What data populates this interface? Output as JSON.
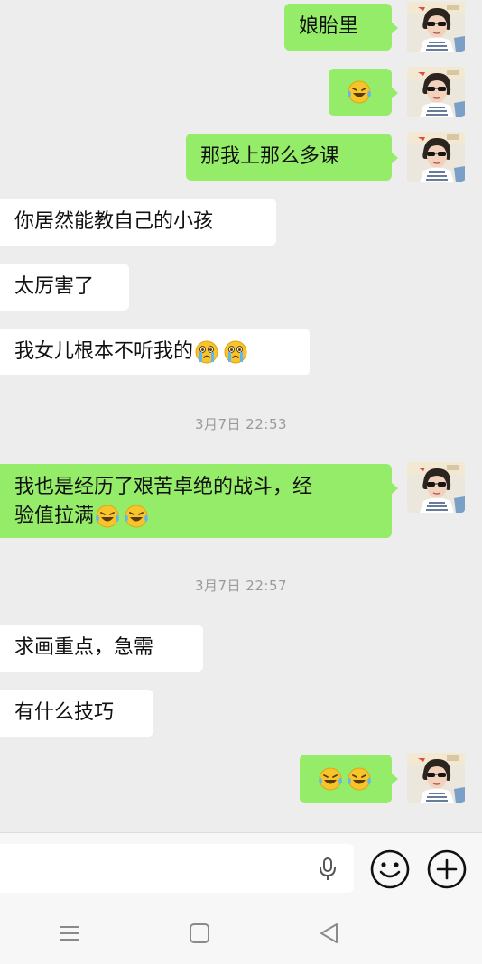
{
  "messages": [
    {
      "side": "out",
      "text": "娘胎里",
      "emojis": 0
    },
    {
      "side": "out",
      "text": "",
      "emojis": 1
    },
    {
      "side": "out",
      "text": "那我上那么多课",
      "emojis": 0
    },
    {
      "side": "in",
      "text": "你居然能教自己的小孩",
      "emojis": 0
    },
    {
      "side": "in",
      "text": "太厉害了",
      "emojis": 0
    },
    {
      "side": "in",
      "text": "我女儿根本不听我的",
      "emojis": 2,
      "emoji_type": "crying"
    },
    {
      "type": "timestamp",
      "text": "3月7日 22:53"
    },
    {
      "side": "out",
      "line1": "我也是经历了艰苦卓绝的战斗，经",
      "line2": "验值拉满",
      "emojis": 2
    },
    {
      "type": "timestamp",
      "text": "3月7日 22:57"
    },
    {
      "side": "in",
      "text": "求画重点，急需",
      "emojis": 0
    },
    {
      "side": "in",
      "text": "有什么技巧",
      "emojis": 0
    },
    {
      "side": "out",
      "text": "",
      "emojis": 2
    }
  ],
  "input": {
    "placeholder": "",
    "value": ""
  },
  "icons": {
    "mic": "microphone-icon",
    "emoji": "smiley-face-icon",
    "plus": "plus-circle-icon",
    "nav_menu": "menu-lines-icon",
    "nav_home": "square-home-icon",
    "nav_back": "triangle-back-icon"
  },
  "colors": {
    "outgoing_bubble": "#95ec69",
    "incoming_bubble": "#ffffff",
    "background": "#ededed"
  }
}
